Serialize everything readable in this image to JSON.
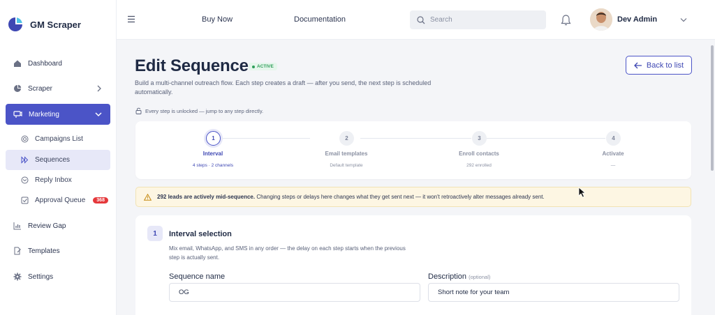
{
  "brand": {
    "name": "GM Scraper"
  },
  "sidebar": {
    "items": [
      {
        "label": "Dashboard"
      },
      {
        "label": "Scraper"
      },
      {
        "label": "Marketing"
      },
      {
        "label": "Review Gap"
      },
      {
        "label": "Templates"
      },
      {
        "label": "Settings"
      }
    ],
    "marketing_sub": [
      {
        "label": "Campaigns List"
      },
      {
        "label": "Sequences"
      },
      {
        "label": "Reply Inbox"
      },
      {
        "label": "Approval Queue",
        "badge": "368"
      }
    ]
  },
  "topbar": {
    "links": [
      "Buy Now",
      "Documentation"
    ],
    "search_placeholder": "Search",
    "user_name": "Dev Admin"
  },
  "page": {
    "title": "Edit Sequence",
    "status": "ACTIVE",
    "description": "Build a multi-channel outreach flow. Each step creates a draft — after you send, the next step is scheduled automatically.",
    "back_label": "Back to list",
    "unlock_note": "Every step is unlocked — jump to any step directly."
  },
  "stepper": {
    "steps": [
      {
        "num": "1",
        "label": "Interval",
        "sub": "4 steps · 2 channels"
      },
      {
        "num": "2",
        "label": "Email templates",
        "sub": "Default template"
      },
      {
        "num": "3",
        "label": "Enroll contacts",
        "sub": "292 enrolled"
      },
      {
        "num": "4",
        "label": "Activate",
        "sub": "—"
      }
    ]
  },
  "alert": {
    "bold": "292 leads are actively mid-sequence.",
    "rest": "Changing steps or delays here changes what they get sent next — it won't retroactively alter messages already sent."
  },
  "card": {
    "num": "1",
    "title": "Interval selection",
    "description": "Mix email, WhatsApp, and SMS in any order — the delay on each step starts when the previous step is actually sent.",
    "name_label": "Sequence name",
    "name_value": "OG",
    "desc_label": "Description",
    "desc_optional": "(optional)",
    "desc_value": "Short note for your team"
  },
  "colors": {
    "accent": "#4b54c7",
    "active_green": "#2f9e5a",
    "badge_red": "#e5383b",
    "alert_bg": "#fdf6e3"
  }
}
